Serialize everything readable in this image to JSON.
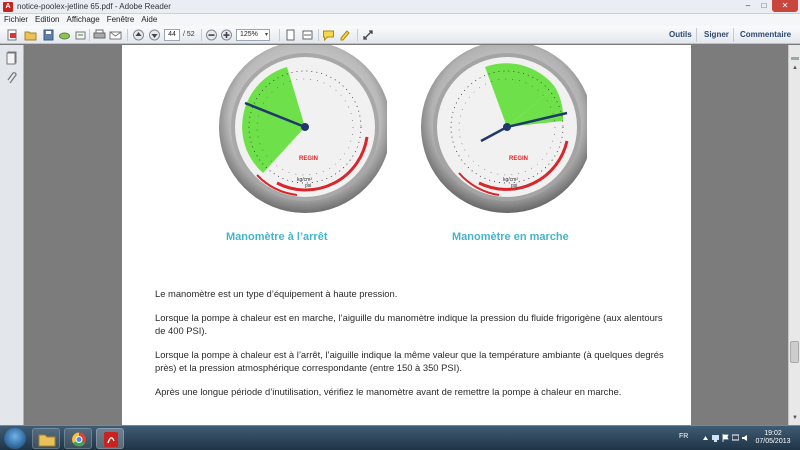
{
  "window": {
    "title": "notice-poolex-jetline 65.pdf - Adobe Reader",
    "minimize": "–",
    "maximize": "□",
    "close": "✕"
  },
  "menu": [
    "Fichier",
    "Edition",
    "Affichage",
    "Fenêtre",
    "Aide"
  ],
  "toolbar": {
    "page_current": "44",
    "page_total": "/ 52",
    "zoom": "125%",
    "zoom_dropdown": "▾",
    "panels": [
      "Outils",
      "Signer",
      "Commentaire"
    ]
  },
  "document": {
    "gauges": [
      {
        "caption": "Manomètre à l’arrêt"
      },
      {
        "caption": "Manomètre en marche"
      }
    ],
    "gauge_text": {
      "brand": "REGIN",
      "units_top": "kg/cm²",
      "units_bottom": "psi"
    },
    "paragraphs": [
      "Le manomètre est un type d’équipement à haute pression.",
      "Lorsque la pompe à chaleur est en marche, l’aiguille du manomètre indique la pression du fluide frigorigène (aux alentours de 400 PSI).",
      "Lorsque la pompe à chaleur est à l’arrêt, l’aiguille indique la même valeur que la température ambiante (à quelques degrés près) et la pression atmosphérique correspondante (entre 150 à 350 PSI).",
      "Après une longue période d’inutilisation, vérifiez le manomètre avant de remettre la pompe à chaleur en marche."
    ]
  },
  "scrollbar": {
    "up": "▲",
    "down": "▼"
  },
  "taskbar": {
    "language": "FR",
    "time": "19:02",
    "date": "07/05/2013"
  },
  "colors": {
    "caption": "#46b4c9",
    "gauge_green": "#6ee04a",
    "gauge_red": "#d8262a",
    "accent_link": "#2b4a6f"
  }
}
